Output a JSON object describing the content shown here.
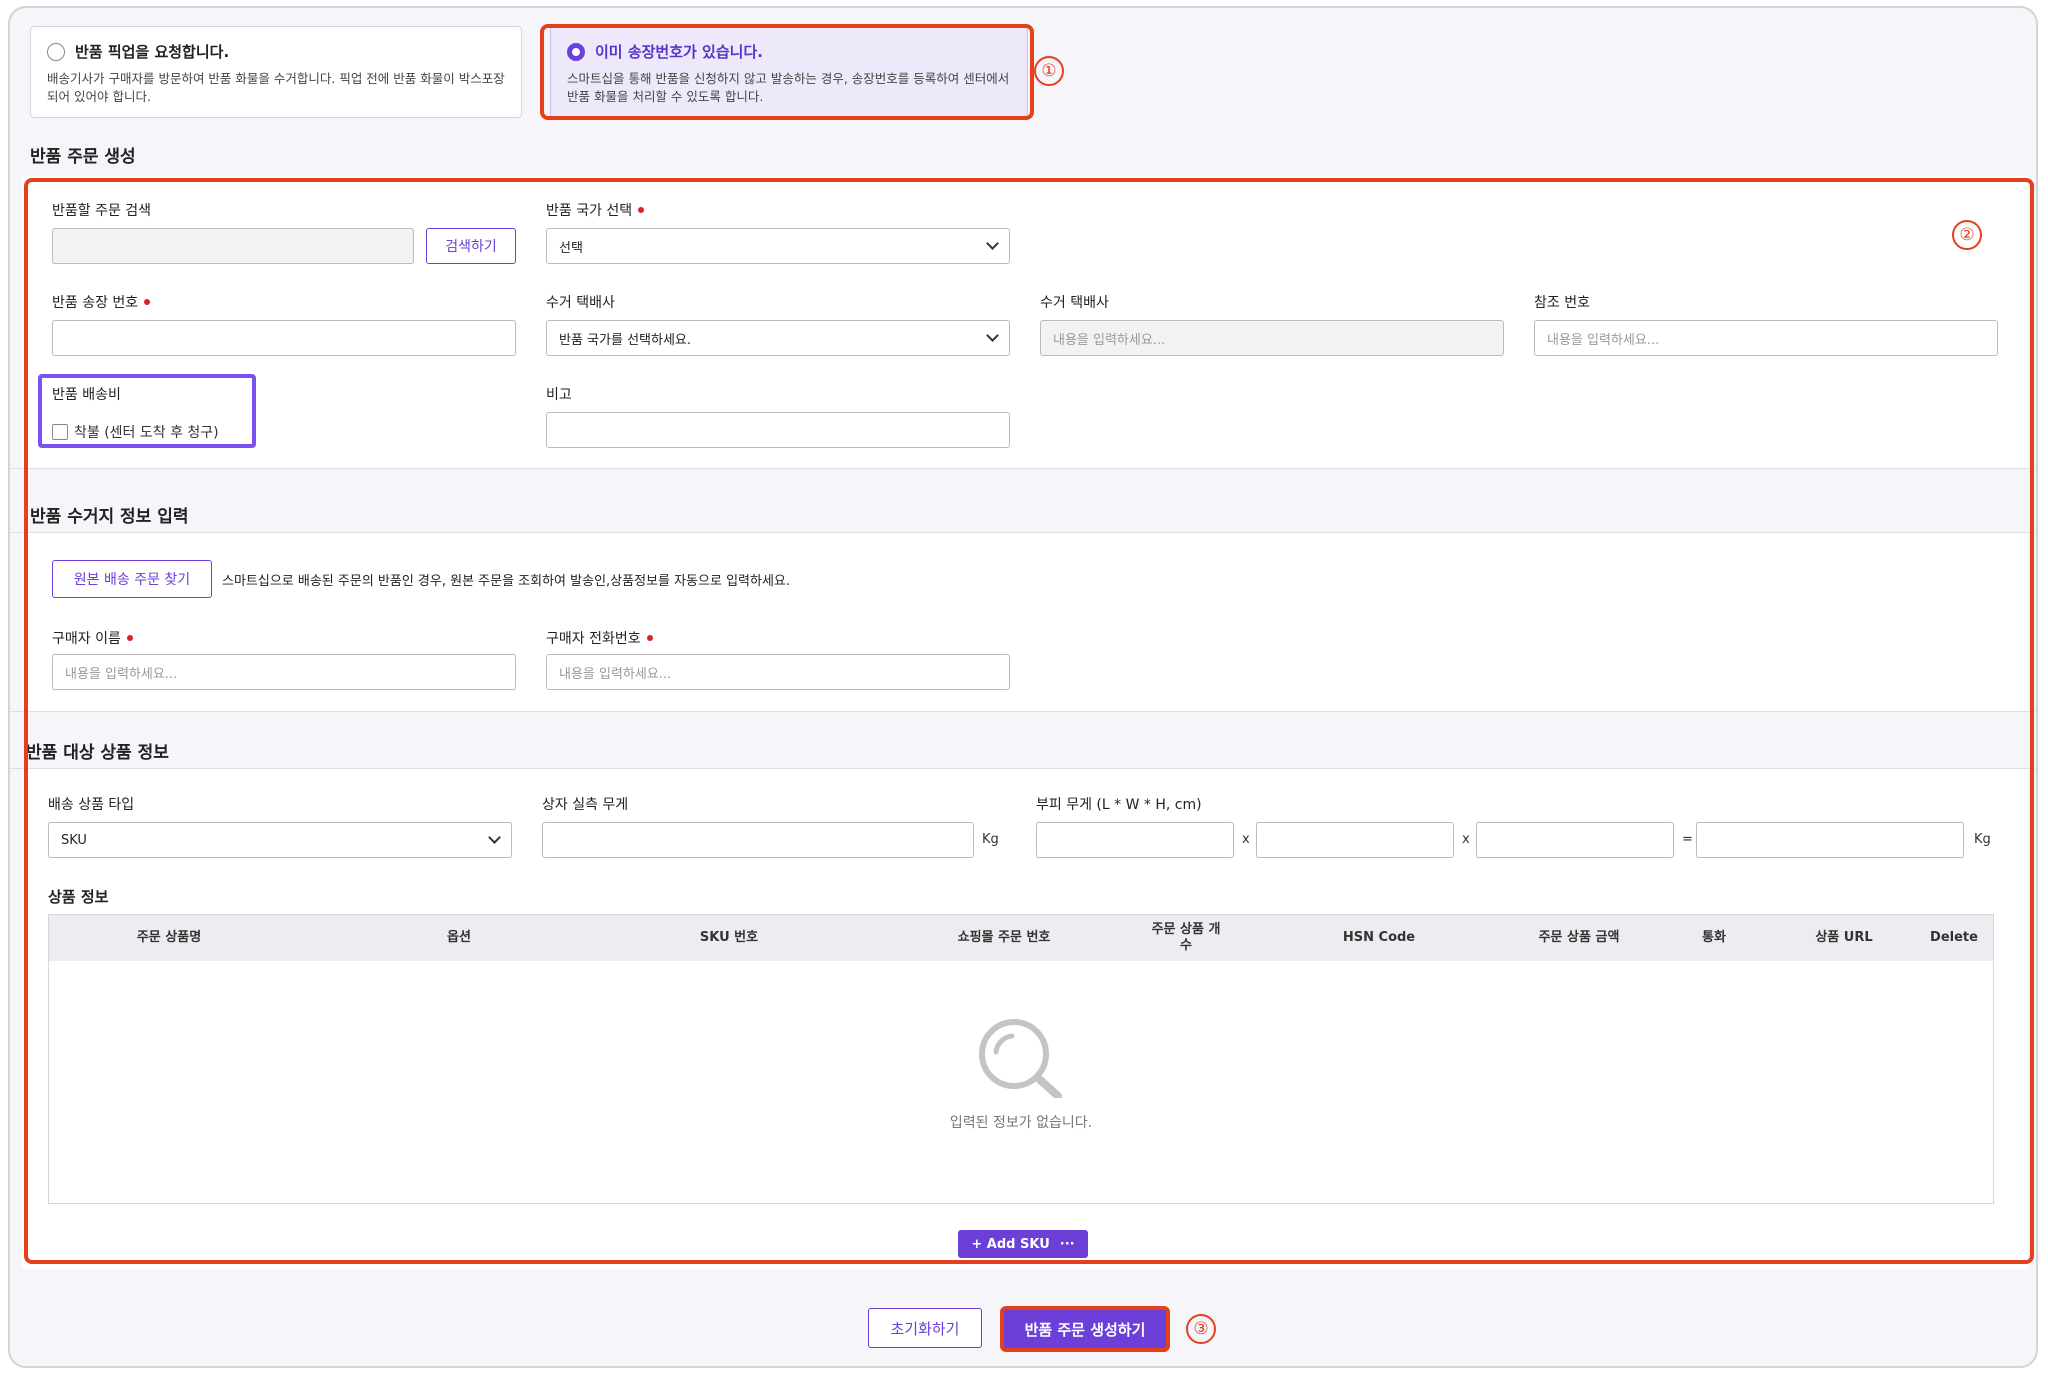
{
  "options": [
    {
      "label": "반품 픽업을 요청합니다.",
      "desc": "배송기사가 구매자를 방문하여 반품 화물을 수거합니다. 픽업 전에 반품 화물이 박스포장되어 있어야 합니다.",
      "selected": false
    },
    {
      "label": "이미 송장번호가 있습니다.",
      "desc": "스마트십을 통해 반품을 신청하지 않고 발송하는 경우, 송장번호를 등록하여 센터에서 반품 화물을 처리할 수 있도록 합니다.",
      "selected": true
    }
  ],
  "markers": [
    "①",
    "②",
    "③"
  ],
  "create_section": {
    "title": "반품 주문 생성",
    "search_label": "반품할 주문 검색",
    "search_button": "검색하기",
    "country_label": "반품 국가 선택",
    "country_value": "선택",
    "tracking_label": "반품 송장 번호",
    "courier_label": "수거 택배사",
    "courier_value": "반품 국가를 선택하세요.",
    "courier2_label": "수거 택배사",
    "courier2_placeholder": "내용을 입력하세요...",
    "ref_label": "참조 번호",
    "ref_placeholder": "내용을 입력하세요...",
    "fee_label": "반품 배송비",
    "fee_checkbox": "착불 (센터 도착 후 청구)",
    "note_label": "비고"
  },
  "pickup_section": {
    "title": "반품 수거지 정보 입력",
    "find_button": "원본 배송 주문 찾기",
    "find_hint": "스마트십으로 배송된 주문의 반품인 경우, 원본 주문을 조회하여 발송인,상품정보를 자동으로 입력하세요.",
    "buyer_name_label": "구매자 이름",
    "buyer_name_placeholder": "내용을 입력하세요...",
    "buyer_phone_label": "구매자 전화번호",
    "buyer_phone_placeholder": "내용을 입력하세요..."
  },
  "product_section": {
    "title": "반품 대상 상품 정보",
    "type_label": "배송 상품 타입",
    "type_value": "SKU",
    "weight_label": "상자 실측 무게",
    "weight_unit": "Kg",
    "volume_label": "부피 무게 (L * W * H, cm)",
    "x1": "x",
    "x2": "x",
    "eq": "=",
    "volume_unit": "Kg",
    "info_title": "상품 정보",
    "columns": [
      "주문 상품명",
      "옵션",
      "SKU 번호",
      "쇼핑몰 주문 번호",
      "주문 상품 개수",
      "HSN Code",
      "주문 상품 금액",
      "통화",
      "상품 URL",
      "Delete"
    ],
    "empty_text": "입력된 정보가 없습니다.",
    "add_sku": "+ Add SKU",
    "add_more": "···"
  },
  "footer": {
    "reset": "초기화하기",
    "submit": "반품 주문 생성하기"
  },
  "colors": {
    "accent": "#6b3fd8",
    "highlight": "#e5401c",
    "selected_bg": "#ede9fb"
  }
}
